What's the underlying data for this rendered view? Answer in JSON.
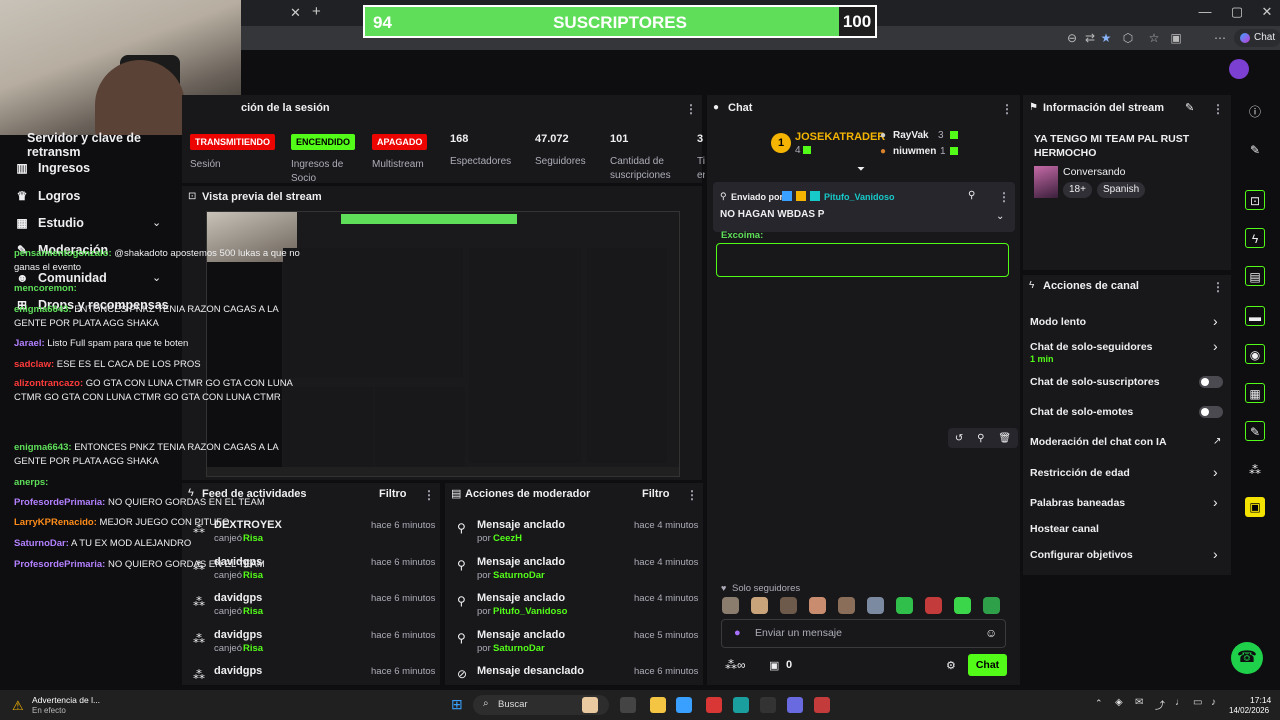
{
  "sub_banner": {
    "current": "94",
    "label": "SUSCRIPTORES",
    "goal": "100",
    "progress": 0.94
  },
  "browser": {
    "chat_button": "Chat"
  },
  "left_nav": {
    "header": "Servidor y clave de retransm",
    "items": [
      {
        "label": "Ingresos",
        "icon": "chart-icon"
      },
      {
        "label": "Logros",
        "icon": "trophy-icon"
      },
      {
        "label": "Estudio",
        "icon": "studio-icon"
      },
      {
        "label": "Moderación",
        "icon": "wrench-icon"
      },
      {
        "label": "Comunidad",
        "icon": "people-icon"
      },
      {
        "label": "Drops y recompensas",
        "icon": "gift-icon"
      }
    ]
  },
  "session_panel": {
    "title": "ción de la sesión",
    "stats": [
      {
        "value_badge": "TRANSMITIENDO",
        "label": "Sesión"
      },
      {
        "value_badge": "ENCENDIDO",
        "label": "Ingresos de Socio"
      },
      {
        "value_badge": "APAGADO",
        "label": "Multistream"
      },
      {
        "value": "168",
        "label": "Espectadores"
      },
      {
        "value": "47.072",
        "label": "Seguidores"
      },
      {
        "value": "101",
        "label": "Cantidad de suscripciones"
      },
      {
        "value": "3",
        "label": "Ti en"
      }
    ]
  },
  "preview_panel": {
    "title": "Vista previa del stream"
  },
  "activity_feed": {
    "title": "Feed de actividades",
    "filter": "Filtro",
    "rows": [
      {
        "user": "DEXTROYEX",
        "action": "canjeó",
        "reward": "Risa",
        "time": "hace 6 minutos"
      },
      {
        "user": "davidgps",
        "action": "canjeó",
        "reward": "Risa",
        "time": "hace 6 minutos"
      },
      {
        "user": "davidgps",
        "action": "canjeó",
        "reward": "Risa",
        "time": "hace 6 minutos"
      },
      {
        "user": "davidgps",
        "action": "canjeó",
        "reward": "Risa",
        "time": "hace 6 minutos"
      },
      {
        "user": "davidgps",
        "action": "",
        "reward": "",
        "time": "hace 6 minutos"
      }
    ]
  },
  "mod_actions": {
    "title": "Acciones de moderador",
    "filter": "Filtro",
    "rows": [
      {
        "action": "Mensaje anclado",
        "by": "por",
        "user": "CeezH",
        "time": "hace 4 minutos"
      },
      {
        "action": "Mensaje anclado",
        "by": "por",
        "user": "SaturnoDar",
        "time": "hace 4 minutos"
      },
      {
        "action": "Mensaje anclado",
        "by": "por",
        "user": "Pitufo_Vanidoso",
        "time": "hace 4 minutos"
      },
      {
        "action": "Mensaje anclado",
        "by": "por",
        "user": "SaturnoDar",
        "time": "hace 5 minutos"
      },
      {
        "action": "Mensaje desanclado",
        "by": "",
        "user": "",
        "time": "hace 6 minutos"
      }
    ]
  },
  "chat": {
    "title": "Chat",
    "leaderboard": {
      "top": "JOSEKATRADER",
      "top_count": "4",
      "second": "RayVak",
      "second_count": "3",
      "third": "niuwmen",
      "third_count": "1",
      "rank": "1"
    },
    "pinned": {
      "prefix": "Enviado por",
      "user": "Pitufo_Vanidoso",
      "message": "NO HAGAN WBDAS P"
    },
    "cut_name": "Excoima:",
    "messages": [
      {
        "user": "pensamientogonzalo:",
        "color": "#5fdf59",
        "text": "@shakadoto apostemos 500 lukas a que no ganas el evento"
      },
      {
        "user": "mencoremon:",
        "color": "#5fdf59",
        "text": ""
      },
      {
        "user": "enigma6643:",
        "color": "#5fdf59",
        "text": "ENTONCES PNKZ TENIA RAZON CAGAS A LA GENTE POR PLATA AGG SHAKA"
      },
      {
        "user": "Jarael:",
        "color": "#b380ff",
        "text": "Listo Full spam para que te boten"
      },
      {
        "user": "sadclaw:",
        "color": "#ff3b3b",
        "text": "ESE ES EL CACA DE LOS PROS"
      },
      {
        "user": "alizontrancazo:",
        "color": "#ff3b3b",
        "text": "GO GTA CON LUNA CTMR GO GTA CON LUNA CTMR GO GTA CON LUNA CTMR GO GTA CON LUNA CTMR"
      },
      {
        "user": "enigma6643:",
        "color": "#5fdf59",
        "text": "ENTONCES PNKZ TENIA RAZON CAGAS A LA GENTE POR PLATA AGG SHAKA"
      },
      {
        "user": "anerps:",
        "color": "#5fdf59",
        "text": ""
      },
      {
        "user": "ProfesordePrimaria:",
        "color": "#b380ff",
        "text": "NO QUIERO GORDAS EN EL TEAM"
      },
      {
        "user": "LarryKPRenacido:",
        "color": "#ff8c1a",
        "text": "MEJOR JUEGO CON PITUFO"
      },
      {
        "user": "SaturnoDar:",
        "color": "#b380ff",
        "text": "A TU EX MOD ALEJANDRO"
      },
      {
        "user": "ProfesordePrimaria:",
        "color": "#b380ff",
        "text": "NO QUIERO GORDAS EN EL TEAM"
      }
    ],
    "followers_only": "Solo seguidores",
    "input_placeholder": "Enviar un mensaje",
    "points": "0",
    "send_label": "Chat"
  },
  "stream_info": {
    "title": "Información del stream",
    "stream_title": "YA TENGO MI TEAM PAL RUST HERMOCHO",
    "category": "Conversando",
    "tags": [
      "18+",
      "Spanish"
    ]
  },
  "channel_actions": {
    "title": "Acciones de canal",
    "rows": [
      {
        "label": "Modo lento",
        "sub": "",
        "control": "chevron"
      },
      {
        "label": "Chat de solo-seguidores",
        "sub": "1 min",
        "control": "chevron"
      },
      {
        "label": "Chat de solo-suscriptores",
        "sub": "",
        "control": "toggle"
      },
      {
        "label": "Chat de solo-emotes",
        "sub": "",
        "control": "toggle"
      },
      {
        "label": "Moderación del chat con IA",
        "sub": "",
        "control": "external"
      },
      {
        "label": "Restricción de edad",
        "sub": "",
        "control": "chevron"
      },
      {
        "label": "Palabras baneadas",
        "sub": "",
        "control": "chevron"
      },
      {
        "label": "Hostear canal",
        "sub": "",
        "control": "none"
      },
      {
        "label": "Configurar objetivos",
        "sub": "",
        "control": "chevron"
      }
    ]
  },
  "taskbar": {
    "warning_title": "Advertencia de l...",
    "warning_sub": "En efecto",
    "search": "Buscar",
    "time": "17:14",
    "date": "14/02/2026"
  },
  "colors": {
    "accent_green": "#53fc18",
    "banner_green": "#5fdf59",
    "panel_bg": "#18181b",
    "page_bg": "#0e0e10",
    "live_red": "#eb0400"
  }
}
